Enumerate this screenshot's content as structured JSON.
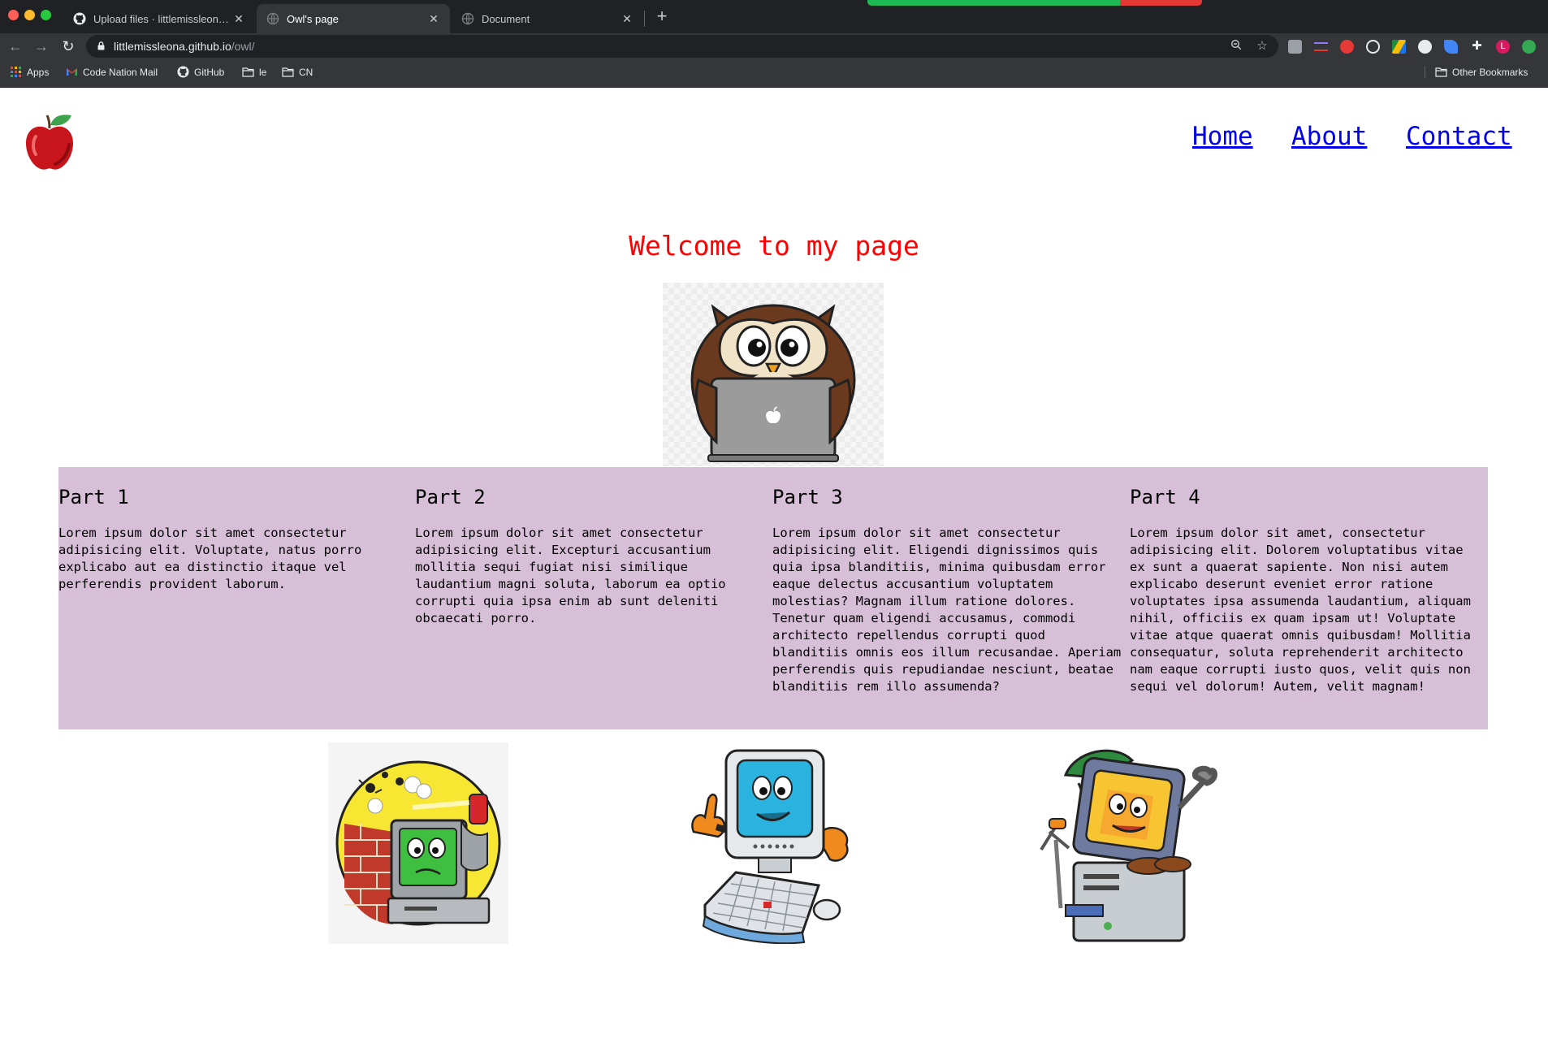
{
  "browser": {
    "tabs": [
      {
        "title": "Upload files · littlemissleona/owl",
        "favicon": "github-icon"
      },
      {
        "title": "Owl's page",
        "favicon": "globe-icon"
      },
      {
        "title": "Document",
        "favicon": "globe-icon"
      }
    ],
    "url_host": "littlemissleona.github.io",
    "url_path": "/owl/",
    "bookmarks": [
      {
        "label": "Apps",
        "icon": "apps-grid-icon"
      },
      {
        "label": "Code Nation Mail",
        "icon": "gmail-icon"
      },
      {
        "label": "GitHub",
        "icon": "github-icon"
      },
      {
        "label": "le",
        "icon": "folder-icon"
      },
      {
        "label": "CN",
        "icon": "folder-icon"
      }
    ],
    "other_bookmarks": "Other Bookmarks",
    "profile_initial": "L"
  },
  "site": {
    "nav": [
      {
        "label": "Home"
      },
      {
        "label": "About"
      },
      {
        "label": "Contact"
      }
    ],
    "welcome": "Welcome to my page",
    "parts": [
      {
        "title": "Part 1",
        "text": "Lorem ipsum dolor sit amet consectetur adipisicing elit. Voluptate, natus porro explicabo aut ea distinctio itaque vel perferendis provident laborum."
      },
      {
        "title": "Part 2",
        "text": "Lorem ipsum dolor sit amet consectetur adipisicing elit. Excepturi accusantium mollitia sequi fugiat nisi similique laudantium magni soluta, laborum ea optio corrupti quia ipsa enim ab sunt deleniti obcaecati porro."
      },
      {
        "title": "Part 3",
        "text": "Lorem ipsum dolor sit amet consectetur adipisicing elit. Eligendi dignissimos quis quia ipsa blanditiis, minima quibusdam error eaque delectus accusantium voluptatem molestias? Magnam illum ratione dolores. Tenetur quam eligendi accusamus, commodi architecto repellendus corrupti quod blanditiis omnis eos illum recusandae. Aperiam perferendis quis repudiandae nesciunt, beatae blanditiis rem illo assumenda?"
      },
      {
        "title": "Part 4",
        "text": "Lorem ipsum dolor sit amet, consectetur adipisicing elit. Dolorem voluptatibus vitae ex sunt a quaerat sapiente. Non nisi autem explicabo deserunt eveniet error ratione voluptates ipsa assumenda laudantium, aliquam nihil, officiis ex quam ipsam ut! Voluptate vitae atque quaerat omnis quibusdam! Mollitia consequatur, soluta reprehenderit architecto nam eaque corrupti iusto quos, velit quis non sequi vel dolorum! Autem, velit magnam!"
      }
    ]
  },
  "colors": {
    "welcome": "#ff0000",
    "link": "#0000ee",
    "band": "#d8bfd8",
    "chrome_dark": "#202124",
    "chrome_toolbar": "#35363a"
  }
}
